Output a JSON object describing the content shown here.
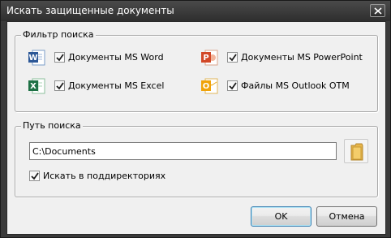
{
  "window": {
    "title": "Искать защищенные документы"
  },
  "filter_group": {
    "label": "Фильтр поиска",
    "items": [
      {
        "icon": "word-icon",
        "label": "Документы MS Word",
        "checked": true
      },
      {
        "icon": "powerpoint-icon",
        "label": "Документы MS PowerPoint",
        "checked": true
      },
      {
        "icon": "excel-icon",
        "label": "Документы MS Excel",
        "checked": true
      },
      {
        "icon": "outlook-icon",
        "label": "Файлы MS Outlook OTM",
        "checked": true
      }
    ]
  },
  "path_group": {
    "label": "Путь поиска",
    "path_value": "C:\\Documents",
    "subdirs_label": "Искать в поддиректориях",
    "subdirs_checked": true
  },
  "buttons": {
    "ok": "OK",
    "cancel": "Отмена"
  },
  "colors": {
    "title_bar": "#3a3a3a",
    "client_bg": "#f0f0f0",
    "word": "#2b5797",
    "excel": "#1e7145",
    "powerpoint": "#d24726",
    "outlook": "#f0a30a"
  }
}
